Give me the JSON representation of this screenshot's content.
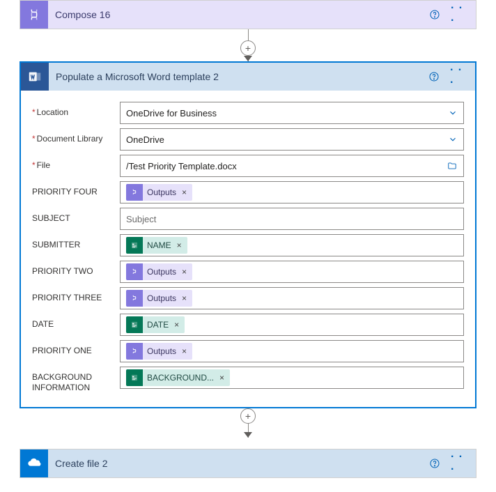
{
  "compose": {
    "title": "Compose 16"
  },
  "word": {
    "title": "Populate a Microsoft Word template 2",
    "labels": {
      "location": "Location",
      "library": "Document Library",
      "file": "File",
      "p4": "PRIORITY FOUR",
      "subject": "SUBJECT",
      "submitter": "SUBMITTER",
      "p2": "PRIORITY TWO",
      "p3": "PRIORITY THREE",
      "date": "DATE",
      "p1": "PRIORITY ONE",
      "bg": "BACKGROUND INFORMATION"
    },
    "values": {
      "location": "OneDrive for Business",
      "library": "OneDrive",
      "file": "/Test Priority Template.docx",
      "subject_placeholder": "Subject"
    },
    "tokens": {
      "outputs": "Outputs",
      "name": "NAME",
      "date": "DATE",
      "background": "BACKGROUND..."
    }
  },
  "createfile": {
    "title": "Create file 2"
  },
  "glyphs": {
    "times": "×",
    "plus": "+",
    "dots": "· · ·"
  }
}
